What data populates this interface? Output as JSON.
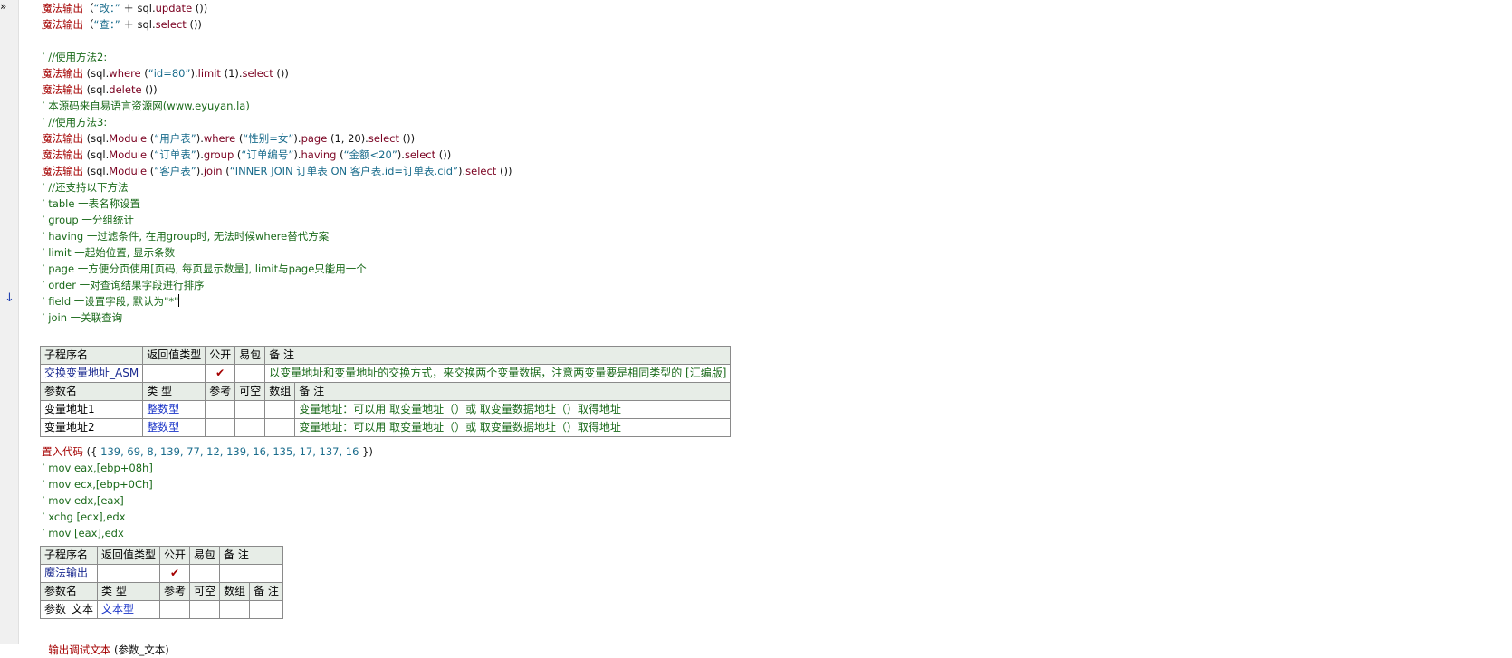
{
  "lines": [
    {
      "parts": [
        {
          "c": "cmd",
          "t": "魔法输出"
        },
        {
          "c": "dark",
          "t": "（"
        },
        {
          "c": "str",
          "t": "“改：”"
        },
        {
          "c": "dark",
          "t": " ＋ sql."
        },
        {
          "c": "mth",
          "t": "update"
        },
        {
          "c": "dark",
          "t": " ())"
        }
      ]
    },
    {
      "parts": [
        {
          "c": "cmd",
          "t": "魔法输出"
        },
        {
          "c": "dark",
          "t": "（"
        },
        {
          "c": "str",
          "t": "“查：”"
        },
        {
          "c": "dark",
          "t": " ＋ sql."
        },
        {
          "c": "mth",
          "t": "select"
        },
        {
          "c": "dark",
          "t": " ())"
        }
      ]
    },
    {
      "parts": []
    },
    {
      "parts": [
        {
          "c": "cmt",
          "t": "’ //使用方法2:"
        }
      ]
    },
    {
      "parts": [
        {
          "c": "cmd",
          "t": "魔法输出"
        },
        {
          "c": "dark",
          "t": " (sql."
        },
        {
          "c": "mth",
          "t": "where"
        },
        {
          "c": "dark",
          "t": " ("
        },
        {
          "c": "str",
          "t": "“id=80”"
        },
        {
          "c": "dark",
          "t": ")."
        },
        {
          "c": "mth",
          "t": "limit"
        },
        {
          "c": "dark",
          "t": " (1)."
        },
        {
          "c": "mth",
          "t": "select"
        },
        {
          "c": "dark",
          "t": " ())"
        }
      ]
    },
    {
      "parts": [
        {
          "c": "cmd",
          "t": "魔法输出"
        },
        {
          "c": "dark",
          "t": " (sql."
        },
        {
          "c": "mth",
          "t": "delete"
        },
        {
          "c": "dark",
          "t": " ())"
        }
      ]
    },
    {
      "parts": [
        {
          "c": "cmt",
          "t": "’ 本源码来自易语言资源网(www.eyuyan.la)"
        }
      ]
    },
    {
      "parts": [
        {
          "c": "cmt",
          "t": "’ //使用方法3:"
        }
      ]
    },
    {
      "parts": [
        {
          "c": "cmd",
          "t": "魔法输出"
        },
        {
          "c": "dark",
          "t": " (sql."
        },
        {
          "c": "mth",
          "t": "Module"
        },
        {
          "c": "dark",
          "t": " ("
        },
        {
          "c": "str",
          "t": "“用户表”"
        },
        {
          "c": "dark",
          "t": ")."
        },
        {
          "c": "mth",
          "t": "where"
        },
        {
          "c": "dark",
          "t": " ("
        },
        {
          "c": "str",
          "t": "“性别=女”"
        },
        {
          "c": "dark",
          "t": ")."
        },
        {
          "c": "mth",
          "t": "page"
        },
        {
          "c": "dark",
          "t": " (1, 20)."
        },
        {
          "c": "mth",
          "t": "select"
        },
        {
          "c": "dark",
          "t": " ())"
        }
      ]
    },
    {
      "parts": [
        {
          "c": "cmd",
          "t": "魔法输出"
        },
        {
          "c": "dark",
          "t": " (sql."
        },
        {
          "c": "mth",
          "t": "Module"
        },
        {
          "c": "dark",
          "t": " ("
        },
        {
          "c": "str",
          "t": "“订单表”"
        },
        {
          "c": "dark",
          "t": ")."
        },
        {
          "c": "mth",
          "t": "group"
        },
        {
          "c": "dark",
          "t": " ("
        },
        {
          "c": "str",
          "t": "“订单编号”"
        },
        {
          "c": "dark",
          "t": ")."
        },
        {
          "c": "mth",
          "t": "having"
        },
        {
          "c": "dark",
          "t": " ("
        },
        {
          "c": "str",
          "t": "“金额<20”"
        },
        {
          "c": "dark",
          "t": ")."
        },
        {
          "c": "mth",
          "t": "select"
        },
        {
          "c": "dark",
          "t": " ())"
        }
      ]
    },
    {
      "parts": [
        {
          "c": "cmd",
          "t": "魔法输出"
        },
        {
          "c": "dark",
          "t": " (sql."
        },
        {
          "c": "mth",
          "t": "Module"
        },
        {
          "c": "dark",
          "t": " ("
        },
        {
          "c": "str",
          "t": "“客户表”"
        },
        {
          "c": "dark",
          "t": ")."
        },
        {
          "c": "mth",
          "t": "join"
        },
        {
          "c": "dark",
          "t": " ("
        },
        {
          "c": "str",
          "t": "“INNER JOIN 订单表 ON 客户表.id=订单表.cid”"
        },
        {
          "c": "dark",
          "t": ")."
        },
        {
          "c": "mth",
          "t": "select"
        },
        {
          "c": "dark",
          "t": " ())"
        }
      ]
    },
    {
      "parts": [
        {
          "c": "cmt",
          "t": "’ //还支持以下方法"
        }
      ]
    },
    {
      "parts": [
        {
          "c": "cmt",
          "t": "’ table 一表名称设置"
        }
      ]
    },
    {
      "parts": [
        {
          "c": "cmt",
          "t": "’ group 一分组统计"
        }
      ]
    },
    {
      "parts": [
        {
          "c": "cmt",
          "t": "’ having 一过滤条件, 在用group时, 无法时候where替代方案"
        }
      ]
    },
    {
      "parts": [
        {
          "c": "cmt",
          "t": "’ limit 一起始位置, 显示条数"
        }
      ]
    },
    {
      "parts": [
        {
          "c": "cmt",
          "t": "’ page 一方便分页使用[页码, 每页显示数量], limit与page只能用一个"
        }
      ]
    },
    {
      "parts": [
        {
          "c": "cmt",
          "t": "’ order 一对查询结果字段进行排序"
        }
      ]
    },
    {
      "parts": [
        {
          "c": "cmt",
          "t": "’ field 一设置字段, 默认为\"*\""
        }
      ],
      "caret": true
    },
    {
      "parts": [
        {
          "c": "cmt",
          "t": "’ join 一关联查询"
        }
      ]
    }
  ],
  "table1": {
    "header": [
      "子程序名",
      "返回值类型",
      "公开",
      "易包",
      "备 注"
    ],
    "row": {
      "name": "交换变量地址_ASM",
      "ret": "",
      "public_mark": "✔",
      "pkg": "",
      "remark": "以变量地址和变量地址的交换方式，来交换两个变量数据，注意两变量要是相同类型的 [汇编版]"
    },
    "param_header": [
      "参数名",
      "类 型",
      "参考",
      "可空",
      "数组",
      "备 注"
    ],
    "params": [
      {
        "name": "变量地址1",
        "type": "整数型",
        "remark": "变量地址：可以用 取变量地址（）或 取变量数据地址（）取得地址"
      },
      {
        "name": "变量地址2",
        "type": "整数型",
        "remark": "变量地址：可以用 取变量地址（）或 取变量数据地址（）取得地址"
      }
    ]
  },
  "lines2": [
    {
      "parts": [
        {
          "c": "cmd",
          "t": "置入代码"
        },
        {
          "c": "dark",
          "t": " ({ "
        },
        {
          "c": "str",
          "t": "139, 69, 8, 139, 77, 12, 139, 16, 135, 17, 137, 16"
        },
        {
          "c": "dark",
          "t": " })"
        }
      ]
    },
    {
      "parts": [
        {
          "c": "cmt",
          "t": "’ mov eax,[ebp+08h]"
        }
      ]
    },
    {
      "parts": [
        {
          "c": "cmt",
          "t": "’ mov ecx,[ebp+0Ch]"
        }
      ]
    },
    {
      "parts": [
        {
          "c": "cmt",
          "t": "’ mov edx,[eax]"
        }
      ]
    },
    {
      "parts": [
        {
          "c": "cmt",
          "t": "’ xchg [ecx],edx"
        }
      ]
    },
    {
      "parts": [
        {
          "c": "cmt",
          "t": "’ mov [eax],edx"
        }
      ]
    }
  ],
  "table2": {
    "header": [
      "子程序名",
      "返回值类型",
      "公开",
      "易包",
      "备 注"
    ],
    "row": {
      "name": "魔法输出",
      "ret": "",
      "public_mark": "✔",
      "pkg": "",
      "remark": ""
    },
    "param_header": [
      "参数名",
      "类 型",
      "参考",
      "可空",
      "数组",
      "备 注"
    ],
    "params": [
      {
        "name": "参数_文本",
        "type": "文本型",
        "remark": ""
      }
    ]
  },
  "last_line": {
    "cmd": "输出调试文本",
    "rest": " (参数_文本)"
  },
  "icons": {
    "breakpoint": "down-arrow-icon",
    "run": "double-chevron-right-icon"
  }
}
